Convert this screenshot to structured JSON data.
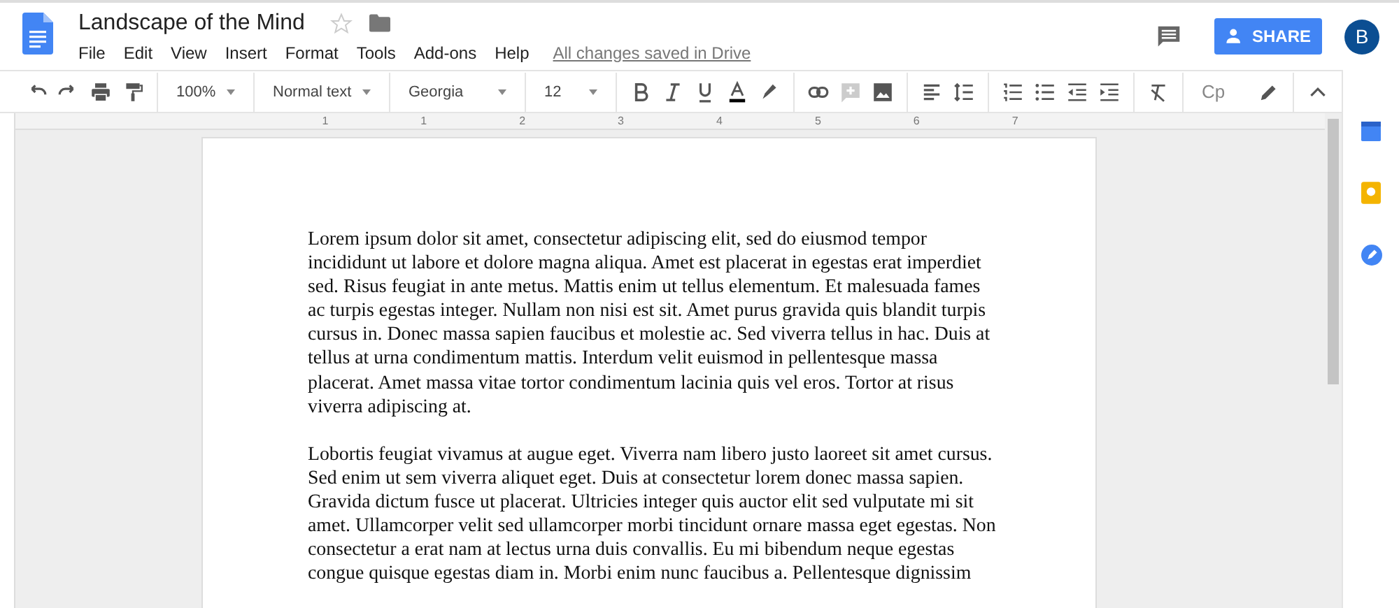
{
  "document": {
    "title": "Landscape of the Mind",
    "starred": false
  },
  "menu": [
    "File",
    "Edit",
    "View",
    "Insert",
    "Format",
    "Tools",
    "Add-ons",
    "Help"
  ],
  "save_status": "All changes saved in Drive",
  "share_button": "SHARE",
  "account": {
    "initial": "B"
  },
  "toolbar": {
    "zoom": "100%",
    "style": "Normal text",
    "font": "Georgia",
    "size": "12",
    "input_tools": "Cp"
  },
  "ruler": [
    "1",
    "1",
    "2",
    "3",
    "4",
    "5",
    "6",
    "7"
  ],
  "paragraphs": [
    "Lorem ipsum dolor sit amet, consectetur adipiscing elit, sed do eiusmod tempor incididunt ut labore et dolore magna aliqua. Amet est placerat in egestas erat imperdiet sed. Risus feugiat in ante metus. Mattis enim ut tellus elementum. Et malesuada fames ac turpis egestas integer. Nullam non nisi est sit. Amet purus gravida quis blandit turpis cursus in. Donec massa sapien faucibus et molestie ac. Sed viverra tellus in hac. Duis at tellus at urna condimentum mattis. Interdum velit euismod in pellentesque massa placerat. Amet massa vitae tortor condimentum lacinia quis vel eros. Tortor at risus viverra adipiscing at.",
    "Lobortis feugiat vivamus at augue eget. Viverra nam libero justo laoreet sit amet cursus. Sed enim ut sem viverra aliquet eget. Duis at consectetur lorem donec massa sapien. Gravida dictum fusce ut placerat. Ultricies integer quis auctor elit sed vulputate mi sit amet. Ullamcorper velit sed ullamcorper morbi tincidunt ornare massa eget egestas. Non consectetur a erat nam at lectus urna duis convallis. Eu mi bibendum neque egestas congue quisque egestas diam in. Morbi enim nunc faucibus a. Pellentesque dignissim"
  ]
}
